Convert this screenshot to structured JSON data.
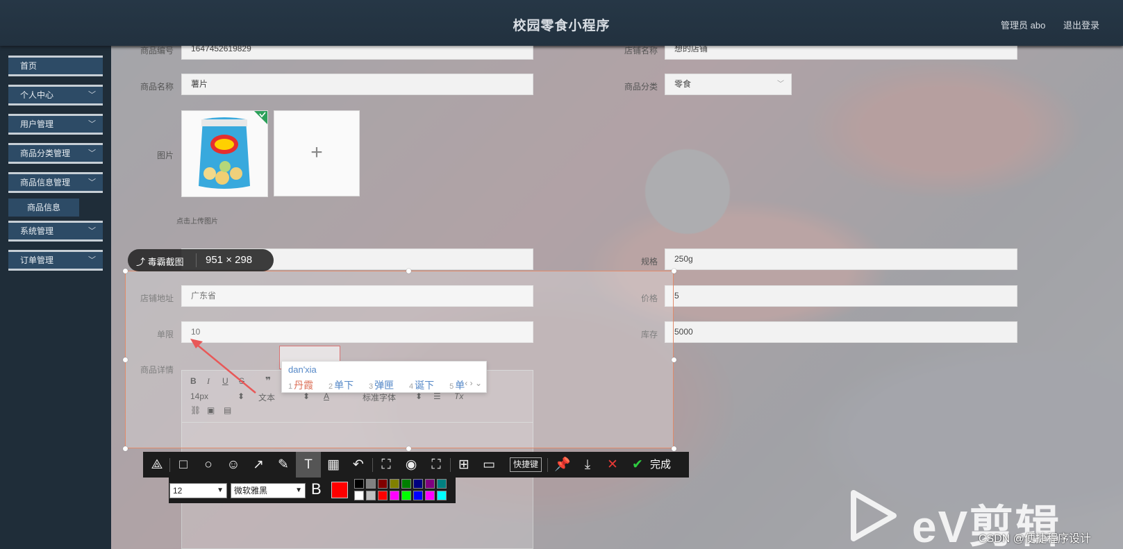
{
  "header": {
    "title": "校园零食小程序",
    "admin": "管理员 abo",
    "logout": "退出登录"
  },
  "sidebar": {
    "items": [
      {
        "label": "首页"
      },
      {
        "label": "个人中心"
      },
      {
        "label": "用户管理"
      },
      {
        "label": "商品分类管理"
      },
      {
        "label": "商品信息管理"
      },
      {
        "label": "系统管理"
      },
      {
        "label": "订单管理"
      }
    ],
    "sub_item": "商品信息"
  },
  "form": {
    "code_label": "商品编号",
    "code_value": "1647452619829",
    "shop_label": "店铺名称",
    "shop_value": "想的店铺",
    "name_label": "商品名称",
    "name_value": "薯片",
    "category_label": "商品分类",
    "category_value": "零食",
    "image_label": "图片",
    "upload_hint": "点击上传图片",
    "spec_label": "规格",
    "spec_value": "250g",
    "address_label": "店铺地址",
    "address_value": "广东省",
    "price_label": "价格",
    "price_value": "5",
    "limit_label": "单限",
    "limit_value": "10",
    "stock_label": "库存",
    "stock_value": "5000",
    "detail_label": "商品详情"
  },
  "editor": {
    "font_size": "14px",
    "paragraph": "文本",
    "font_family": "标准字体"
  },
  "ime": {
    "pinyin": "dan'xia",
    "candidates": [
      {
        "n": "1",
        "text": "丹霞"
      },
      {
        "n": "2",
        "text": "单下"
      },
      {
        "n": "3",
        "text": "弹匣"
      },
      {
        "n": "4",
        "text": "诞下"
      },
      {
        "n": "5",
        "text": "单"
      }
    ]
  },
  "screenshot_tool": {
    "brand": "毒霸截图",
    "dims": "951 × 298",
    "shortcut_label": "快捷键",
    "done_label": "完成",
    "font_size": "12",
    "font_family": "微软雅黑",
    "bold_glyph": "B",
    "current_color": "#ff0000",
    "palette": [
      "#000000",
      "#808080",
      "#800000",
      "#808000",
      "#008000",
      "#000080",
      "#800080",
      "#008080",
      "#ffffff",
      "#c0c0c0",
      "#ff0000",
      "#ff00ff",
      "#00ff00",
      "#0000ff",
      "#ff00ff",
      "#00ffff"
    ]
  },
  "watermark": {
    "brand_text": "eV剪辑",
    "csdn": "CSDN @便捷程序设计"
  }
}
